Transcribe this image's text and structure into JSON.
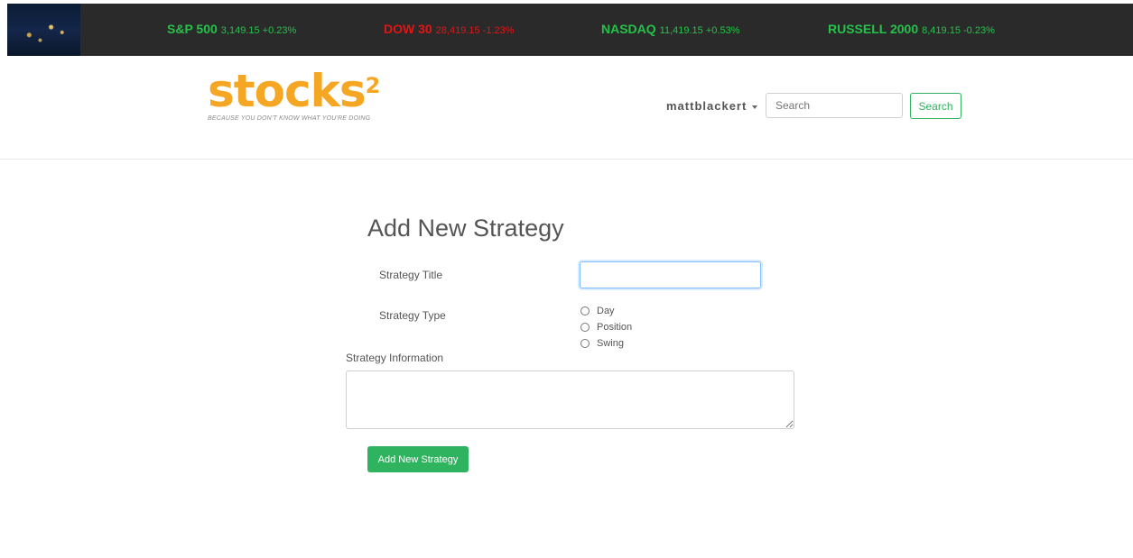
{
  "ticker": [
    {
      "symbol": "S&P 500",
      "value": "3,149.15 +0.23%",
      "direction": "up"
    },
    {
      "symbol": "DOW 30",
      "value": "28,419.15 -1.23%",
      "direction": "down"
    },
    {
      "symbol": "NASDAQ",
      "value": "11,419.15 +0.53%",
      "direction": "up"
    },
    {
      "symbol": "RUSSELL 2000",
      "value": "8,419.15 -0.23%",
      "direction": "up"
    }
  ],
  "brand": {
    "logo_text": "stocks",
    "logo_superscript": "2",
    "tagline": "BECAUSE YOU DON'T KNOW WHAT YOU'RE DOING"
  },
  "nav": {
    "username": "mattblackert",
    "search_placeholder": "Search",
    "search_button": "Search"
  },
  "form": {
    "title": "Add New Strategy",
    "strategy_title_label": "Strategy Title",
    "strategy_title_value": "",
    "strategy_type_label": "Strategy Type",
    "types": [
      "Day",
      "Position",
      "Swing"
    ],
    "info_label": "Strategy Information",
    "submit_label": "Add New Strategy"
  },
  "colors": {
    "up": "#25c24a",
    "down": "#e01515",
    "brand": "#f5a623",
    "accent": "#2fb35e"
  }
}
